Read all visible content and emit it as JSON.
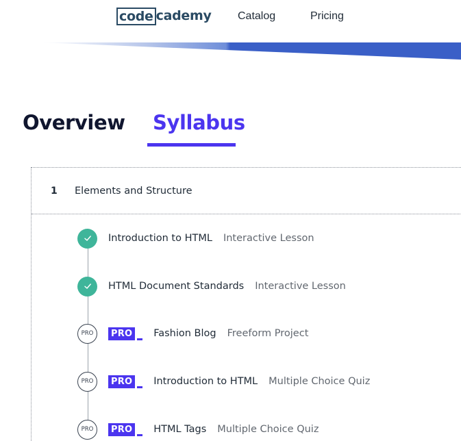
{
  "header": {
    "logo": {
      "part1": "code",
      "part2": "cademy"
    },
    "nav": {
      "catalog": "Catalog",
      "pricing": "Pricing"
    }
  },
  "colors": {
    "accent": "#4b35ef",
    "success": "#3fb59a",
    "banner": "#3a5fc7",
    "text": "#1f2a36",
    "muted": "#61676f"
  },
  "tabs": {
    "overview": "Overview",
    "syllabus": "Syllabus",
    "active": "syllabus"
  },
  "module": {
    "number": "1",
    "title": "Elements and Structure"
  },
  "lessons": [
    {
      "status": "completed",
      "status_icon": "check-icon",
      "pro": false,
      "title": "Introduction to HTML",
      "type": "Interactive Lesson"
    },
    {
      "status": "completed",
      "status_icon": "check-icon",
      "pro": false,
      "title": "HTML Document Standards",
      "type": "Interactive Lesson"
    },
    {
      "status": "pro",
      "status_label": "PRO",
      "pro": true,
      "pro_badge": "PRO",
      "title": "Fashion Blog",
      "type": "Freeform Project"
    },
    {
      "status": "pro",
      "status_label": "PRO",
      "pro": true,
      "pro_badge": "PRO",
      "title": "Introduction to HTML",
      "type": "Multiple Choice Quiz"
    },
    {
      "status": "pro",
      "status_label": "PRO",
      "pro": true,
      "pro_badge": "PRO",
      "title": "HTML Tags",
      "type": "Multiple Choice Quiz"
    }
  ]
}
